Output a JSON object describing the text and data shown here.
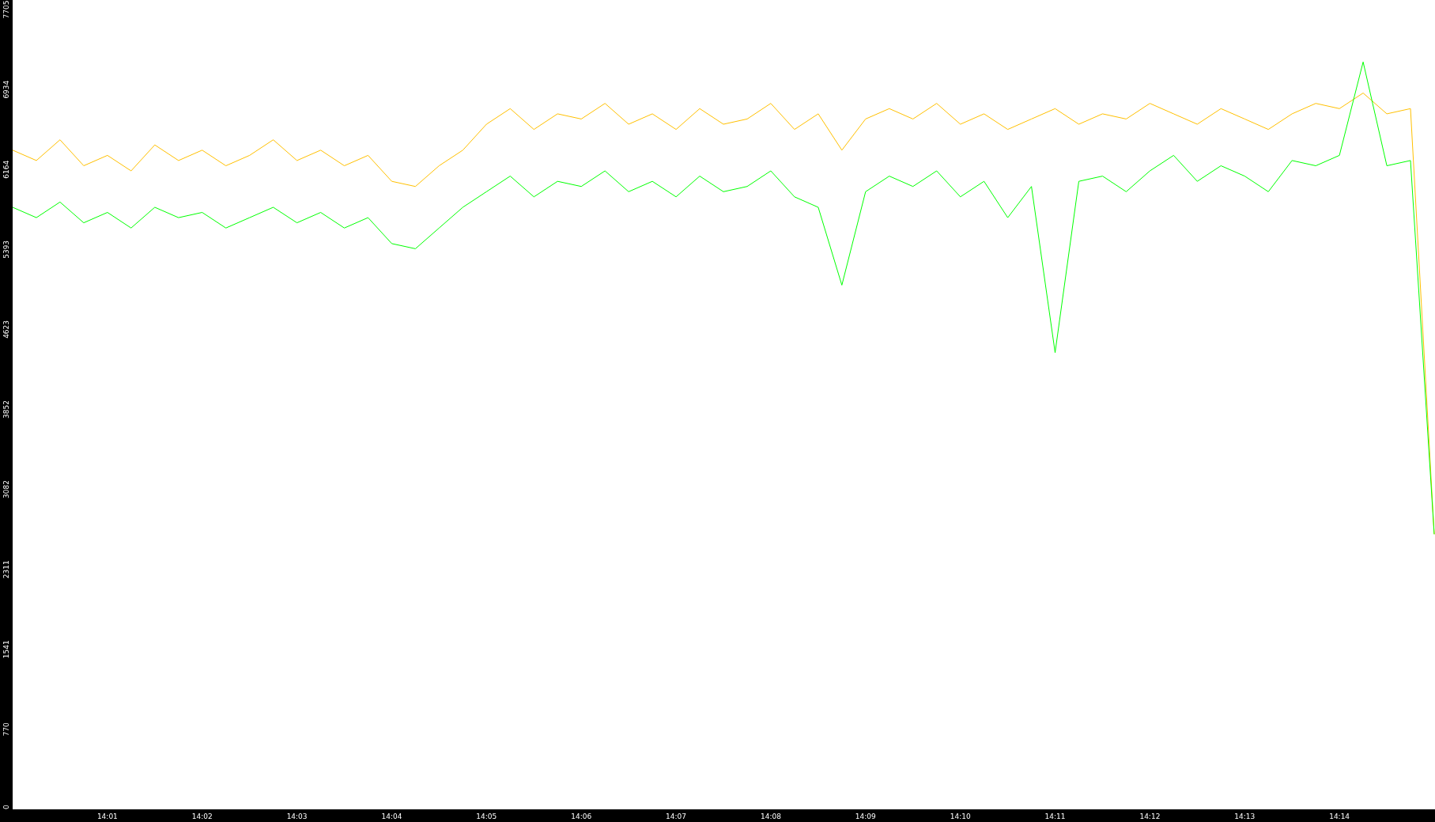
{
  "chart_data": {
    "type": "line",
    "categories": [
      null,
      null,
      null,
      null,
      "14:01",
      null,
      null,
      null,
      "14:02",
      null,
      null,
      null,
      "14:03",
      null,
      null,
      null,
      "14:04",
      null,
      null,
      null,
      "14:05",
      null,
      null,
      null,
      "14:06",
      null,
      null,
      null,
      "14:07",
      null,
      null,
      null,
      "14:08",
      null,
      null,
      null,
      "14:09",
      null,
      null,
      null,
      "14:10",
      null,
      null,
      null,
      "14:11",
      null,
      null,
      null,
      "14:12",
      null,
      null,
      null,
      "14:13",
      null,
      null,
      null,
      "14:14",
      null,
      null,
      null,
      null
    ],
    "series": [
      {
        "color": "#ffc000",
        "values": [
          6350,
          6250,
          6450,
          6200,
          6300,
          6150,
          6400,
          6250,
          6350,
          6200,
          6300,
          6450,
          6250,
          6350,
          6200,
          6300,
          6050,
          6000,
          6200,
          6350,
          6600,
          6750,
          6550,
          6700,
          6650,
          6800,
          6600,
          6700,
          6550,
          6750,
          6600,
          6650,
          6800,
          6550,
          6700,
          6350,
          6650,
          6750,
          6650,
          6800,
          6600,
          6700,
          6550,
          6650,
          6750,
          6600,
          6700,
          6650,
          6800,
          6700,
          6600,
          6750,
          6650,
          6550,
          6700,
          6800,
          6750,
          6900,
          6700,
          6750,
          2650
        ]
      },
      {
        "color": "#00ff00",
        "values": [
          5800,
          5700,
          5850,
          5650,
          5750,
          5600,
          5800,
          5700,
          5750,
          5600,
          5700,
          5800,
          5650,
          5750,
          5600,
          5700,
          5450,
          5400,
          5600,
          5800,
          5950,
          6100,
          5900,
          6050,
          6000,
          6150,
          5950,
          6050,
          5900,
          6100,
          5950,
          6000,
          6150,
          5900,
          5800,
          5050,
          5950,
          6100,
          6000,
          6150,
          5900,
          6050,
          5700,
          6000,
          4400,
          6050,
          6100,
          5950,
          6150,
          6300,
          6050,
          6200,
          6100,
          5950,
          6250,
          6200,
          6300,
          7200,
          6200,
          6250,
          2650
        ]
      }
    ],
    "ylim": [
      0,
      7705
    ],
    "yticks": [
      7705,
      6934,
      6164,
      5393,
      4623,
      3852,
      3082,
      2311,
      1541,
      770,
      0
    ]
  }
}
